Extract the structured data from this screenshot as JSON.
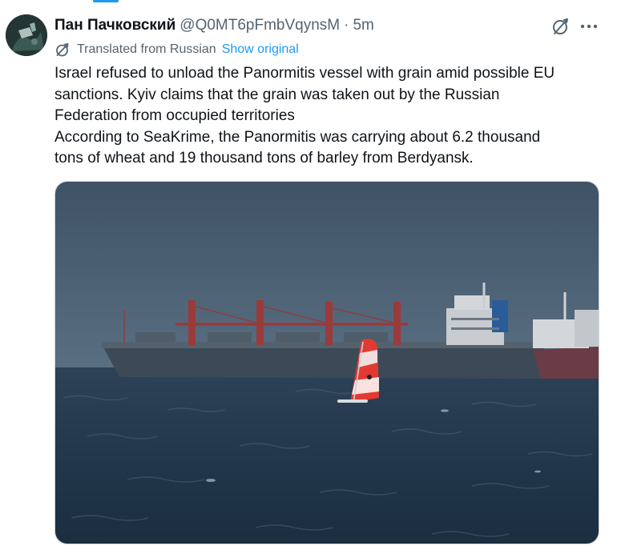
{
  "author": {
    "display_name": "Пан Пачковский",
    "handle": "@Q0MT6pFmbVqynsM",
    "separator": "·",
    "time": "5m"
  },
  "translation": {
    "label": "Translated from Russian",
    "show_original": "Show original"
  },
  "tweet": {
    "lines": [
      "Israel refused to unload the Panormitis vessel with grain amid possible EU",
      "sanctions. Kyiv claims that the grain was taken out by the Russian",
      "Federation from occupied territories",
      "According to SeaKrime, the Panormitis was carrying about 6.2 thousand",
      "tons of wheat and 19 thousand tons of barley from Berdyansk."
    ]
  },
  "icons": {
    "grok": "grok-icon",
    "more": "more-icon",
    "translate": "translate-icon"
  },
  "colors": {
    "link": "#1d9bf0",
    "secondary_text": "#536471",
    "primary_text": "#0f1419"
  }
}
